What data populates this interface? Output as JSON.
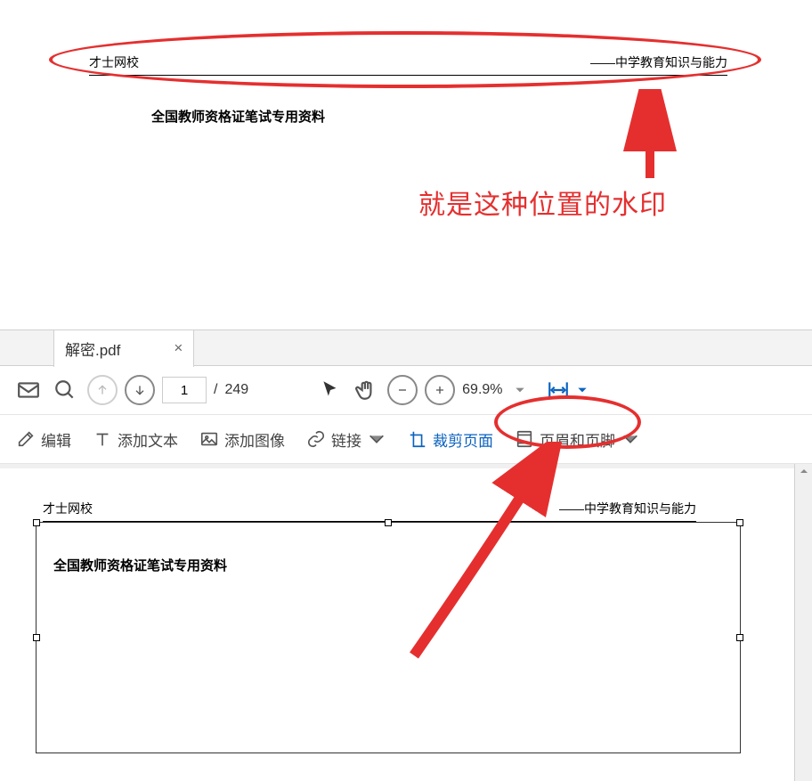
{
  "top": {
    "header_left": "才士网校",
    "header_right": "——中学教育知识与能力",
    "subtitle": "全国教师资格证笔试专用资料",
    "annotation": "就是这种位置的水印"
  },
  "app": {
    "tab": {
      "title": "解密.pdf",
      "close": "×"
    },
    "toolbar": {
      "page_current": "1",
      "page_sep": "/",
      "page_total": "249",
      "zoom": "69.9%"
    },
    "edit": {
      "edit": "编辑",
      "add_text": "添加文本",
      "add_image": "添加图像",
      "link": "链接",
      "crop_page": "裁剪页面",
      "header_footer": "页眉和页脚"
    },
    "doc": {
      "header_left": "才士网校",
      "header_right": "——中学教育知识与能力",
      "subtitle": "全国教师资格证笔试专用资料"
    }
  }
}
